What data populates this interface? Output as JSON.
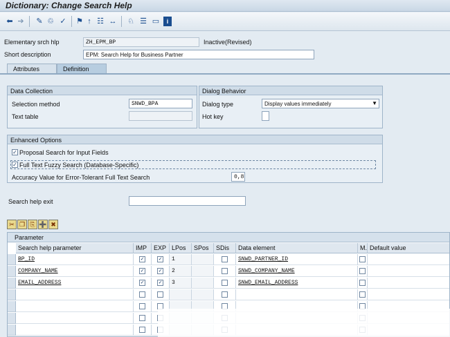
{
  "window": {
    "title": "Dictionary: Change Search Help"
  },
  "toolbar": {
    "icons": [
      "back-arrow-icon",
      "forward-arrow-icon",
      "edit-toggle-icon",
      "other-object-icon",
      "check-icon",
      "activate-icon",
      "where-used-icon",
      "display-object-list-icon",
      "hierarchy-icon",
      "navigation-window-icon",
      "info-icon"
    ]
  },
  "header": {
    "elementary_label": "Elementary srch hlp",
    "elementary_value": "ZH_EPM_BP",
    "status": "Inactive(Revised)",
    "short_desc_label": "Short description",
    "short_desc_value": "EPM: Search Help for Business Partner"
  },
  "tabs": [
    "Attributes",
    "Definition"
  ],
  "data_collection": {
    "title": "Data Collection",
    "selection_method_label": "Selection method",
    "selection_method_value": "SNWD_BPA",
    "text_table_label": "Text table",
    "text_table_value": ""
  },
  "dialog_behavior": {
    "title": "Dialog Behavior",
    "dialog_type_label": "Dialog type",
    "dialog_type_value": "Display values immediately",
    "hot_key_label": "Hot key",
    "hot_key_value": ""
  },
  "enhanced": {
    "title": "Enhanced Options",
    "proposal_label": "Proposal Search for Input Fields",
    "proposal_checked": true,
    "fuzzy_label": "Full Text Fuzzy Search (Database-Specific)",
    "fuzzy_checked": true,
    "accuracy_label": "Accuracy Value for Error-Tolerant Full Text Search",
    "accuracy_value": "0,8"
  },
  "search_help_exit": {
    "label": "Search help exit",
    "value": ""
  },
  "parameter_table": {
    "title": "Parameter",
    "columns": [
      "Search help parameter",
      "IMP",
      "EXP",
      "LPos",
      "SPos",
      "SDis",
      "Data element",
      "M...",
      "Default value"
    ],
    "rows": [
      {
        "param": "BP_ID",
        "imp": true,
        "exp": true,
        "lpos": "1",
        "spos": "",
        "sdis": false,
        "element": "SNWD_PARTNER_ID",
        "m": false,
        "default": ""
      },
      {
        "param": "COMPANY_NAME",
        "imp": true,
        "exp": true,
        "lpos": "2",
        "spos": "",
        "sdis": false,
        "element": "SNWD_COMPANY_NAME",
        "m": false,
        "default": ""
      },
      {
        "param": "EMAIL_ADDRESS",
        "imp": true,
        "exp": true,
        "lpos": "3",
        "spos": "",
        "sdis": false,
        "element": "SNWD_EMAIL_ADDRESS",
        "m": false,
        "default": ""
      },
      {
        "param": "",
        "imp": false,
        "exp": false,
        "lpos": "",
        "spos": "",
        "sdis": false,
        "element": "",
        "m": false,
        "default": ""
      },
      {
        "param": "",
        "imp": false,
        "exp": false,
        "lpos": "",
        "spos": "",
        "sdis": false,
        "element": "",
        "m": false,
        "default": ""
      },
      {
        "param": "",
        "imp": false,
        "exp": false,
        "lpos": "",
        "spos": "",
        "sdis": false,
        "element": "",
        "m": false,
        "default": ""
      },
      {
        "param": "",
        "imp": false,
        "exp": false,
        "lpos": "",
        "spos": "",
        "sdis": false,
        "element": "",
        "m": false,
        "default": ""
      },
      {
        "param": "",
        "imp": false,
        "exp": false,
        "lpos": "",
        "spos": "",
        "sdis": false,
        "element": "",
        "m": false,
        "default": ""
      }
    ]
  }
}
